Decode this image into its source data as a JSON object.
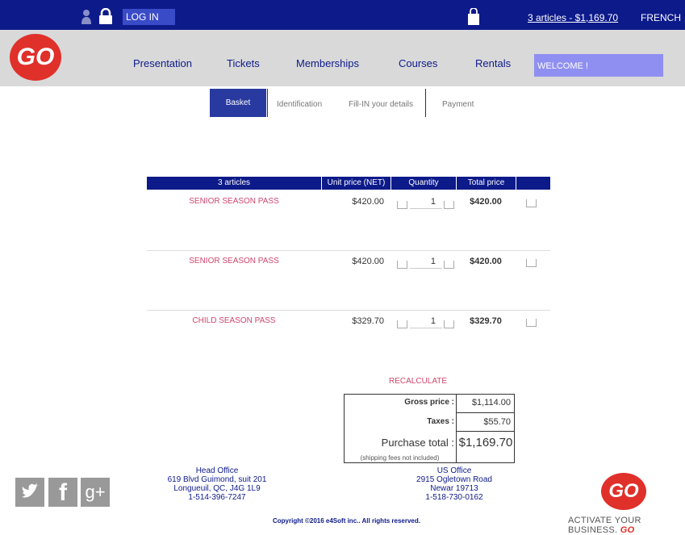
{
  "topbar": {
    "login_label": "LOG IN",
    "cart_summary": "3 articles - $1,169.70",
    "language": "FRENCH"
  },
  "brand": {
    "logo_text": "GO"
  },
  "nav": {
    "items": [
      "Presentation",
      "Tickets",
      "Memberships",
      "Courses",
      "Rentals"
    ],
    "welcome": "WELCOME !"
  },
  "steps": [
    "Basket",
    "Identification",
    "Fill-IN your details",
    "Payment"
  ],
  "table": {
    "headers": [
      "3 articles",
      "Unit price (NET)",
      "Quantity",
      "Total price"
    ],
    "rows": [
      {
        "name": "SENIOR SEASON PASS",
        "unit": "$420.00",
        "qty": "1",
        "total": "$420.00"
      },
      {
        "name": "SENIOR SEASON PASS",
        "unit": "$420.00",
        "qty": "1",
        "total": "$420.00"
      },
      {
        "name": "CHILD SEASON PASS",
        "unit": "$329.70",
        "qty": "1",
        "total": "$329.70"
      }
    ]
  },
  "recalculate": "RECALCULATE",
  "summary": {
    "gross_label": "Gross price :",
    "gross_value": "$1,114.00",
    "taxes_label": "Taxes :",
    "taxes_value": "$55.70",
    "total_label": "Purchase total :",
    "total_value": "$1,169.70",
    "shipping_note": "(shipping fees not included)"
  },
  "footer": {
    "head_office": [
      "Head Office",
      "619 Blvd Guimond, suit 201",
      "Longueuil, QC, J4G 1L9",
      "1-514-396-7247"
    ],
    "us_office": [
      "US Office",
      "2915 Ogletown Road",
      "Newar 19713",
      "1-518-730-0162"
    ],
    "copyright": "Copyright ©2016 e4Soft inc.. All rights reserved.",
    "tagline": "ACTIVATE YOUR BUSINESS.",
    "tagline_brand": "GO"
  },
  "colors": {
    "navy": "#0d1a8a",
    "accent_pink": "#d0476f",
    "brand_red": "#e0302a",
    "welcome": "#8f8ff2"
  }
}
